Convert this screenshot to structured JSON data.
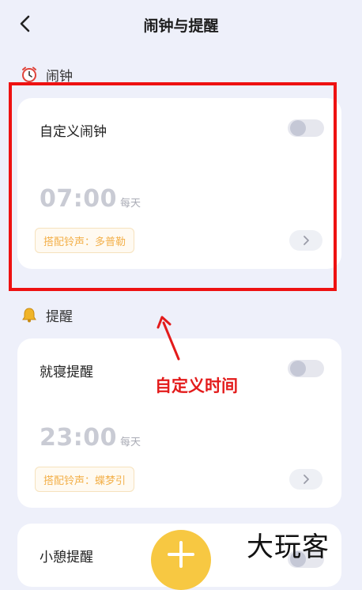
{
  "header": {
    "title": "闹钟与提醒"
  },
  "alarm_section": {
    "label": "闹钟",
    "icon": "alarm-clock-icon",
    "card": {
      "title": "自定义闹钟",
      "enabled": false,
      "time": "07:00",
      "repeat": "每天",
      "ringtone": "搭配铃声：多普勒"
    }
  },
  "reminder_section": {
    "label": "提醒",
    "icon": "bell-icon",
    "cards": [
      {
        "title": "就寝提醒",
        "enabled": false,
        "time": "23:00",
        "repeat": "每天",
        "ringtone": "搭配铃声：蝶梦引"
      },
      {
        "title": "小憩提醒"
      }
    ]
  },
  "annotation": {
    "text": "自定义时间",
    "color": "#e31b1b"
  },
  "watermark": "大玩客",
  "colors": {
    "background": "#eef0fa",
    "ringtone_text": "#f3b04a",
    "fab": "#f7c842",
    "highlight": "#ee1111"
  }
}
